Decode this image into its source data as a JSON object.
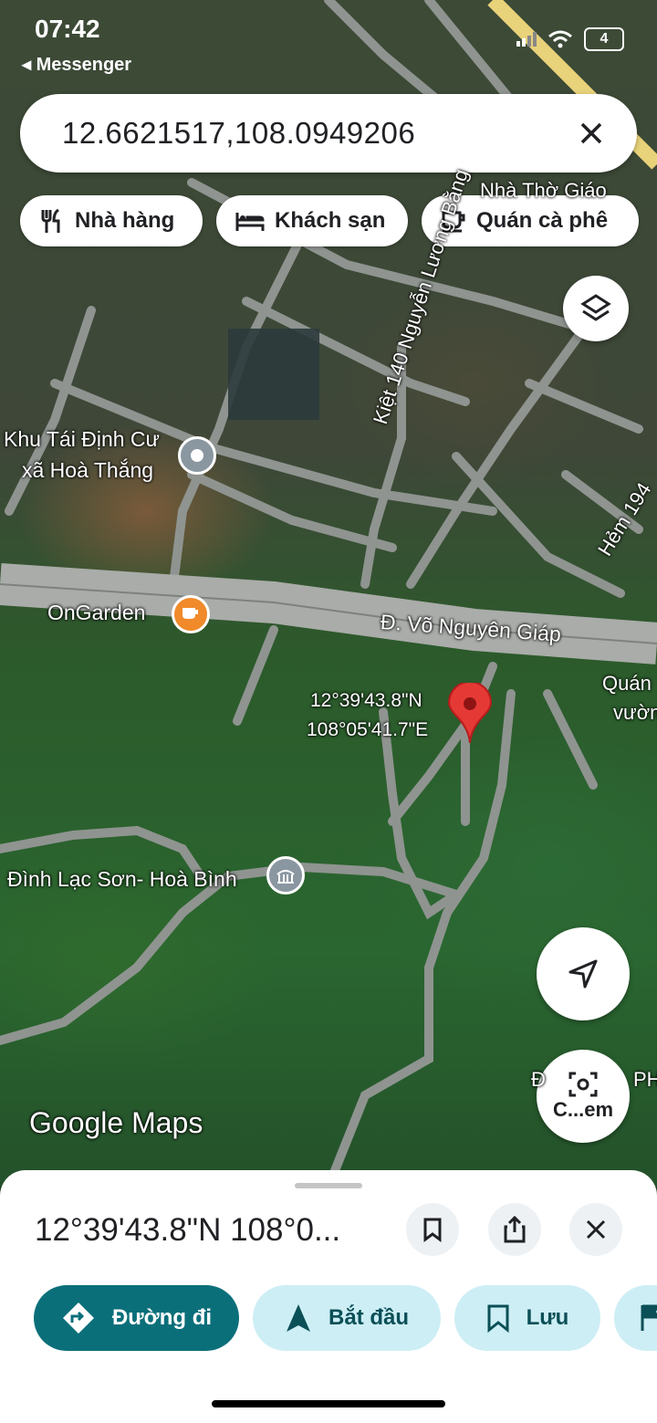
{
  "status_bar": {
    "time": "07:42",
    "back_label": "◂ Messenger",
    "battery": "4"
  },
  "search": {
    "value": "12.6621517,108.0949206"
  },
  "chips": [
    {
      "label": "Nhà hàng",
      "icon": "restaurant-icon"
    },
    {
      "label": "Khách sạn",
      "icon": "hotel-icon"
    },
    {
      "label": "Quán cà phê",
      "icon": "coffee-icon"
    }
  ],
  "map": {
    "labels": {
      "nha_tho": "Nhà Thờ Giáo",
      "kiet": "Kiệt 140 Nguyễn Lương Bằng",
      "khu_line1": "Khu Tái Định Cư",
      "khu_line2": "xã Hoà Thắng",
      "hem": "Hẻm 194",
      "ongarden": "OnGarden",
      "vo_nguyen_giap": "Đ. Võ Nguyên Giáp",
      "quan_line1": "Quán",
      "quan_line2": "vườn",
      "coord_line1": "12°39'43.8\"N",
      "coord_line2": "108°05'41.7\"E",
      "dinh": "Đình Lạc Sơn- Hoà Bình",
      "ph_label": "PH",
      "d_label": "Đ",
      "google_maps": "Google Maps"
    },
    "camera_label": "C...em"
  },
  "sheet": {
    "title": "12°39'43.8\"N 108°0...",
    "actions": [
      {
        "label": "Đường đi",
        "style": "primary"
      },
      {
        "label": "Bắt đầu",
        "style": "secondary"
      },
      {
        "label": "Lưu",
        "style": "secondary"
      }
    ]
  },
  "colors": {
    "primary": "#0b6f7a",
    "secondary": "#cdeef5",
    "pin": "#e53935"
  }
}
